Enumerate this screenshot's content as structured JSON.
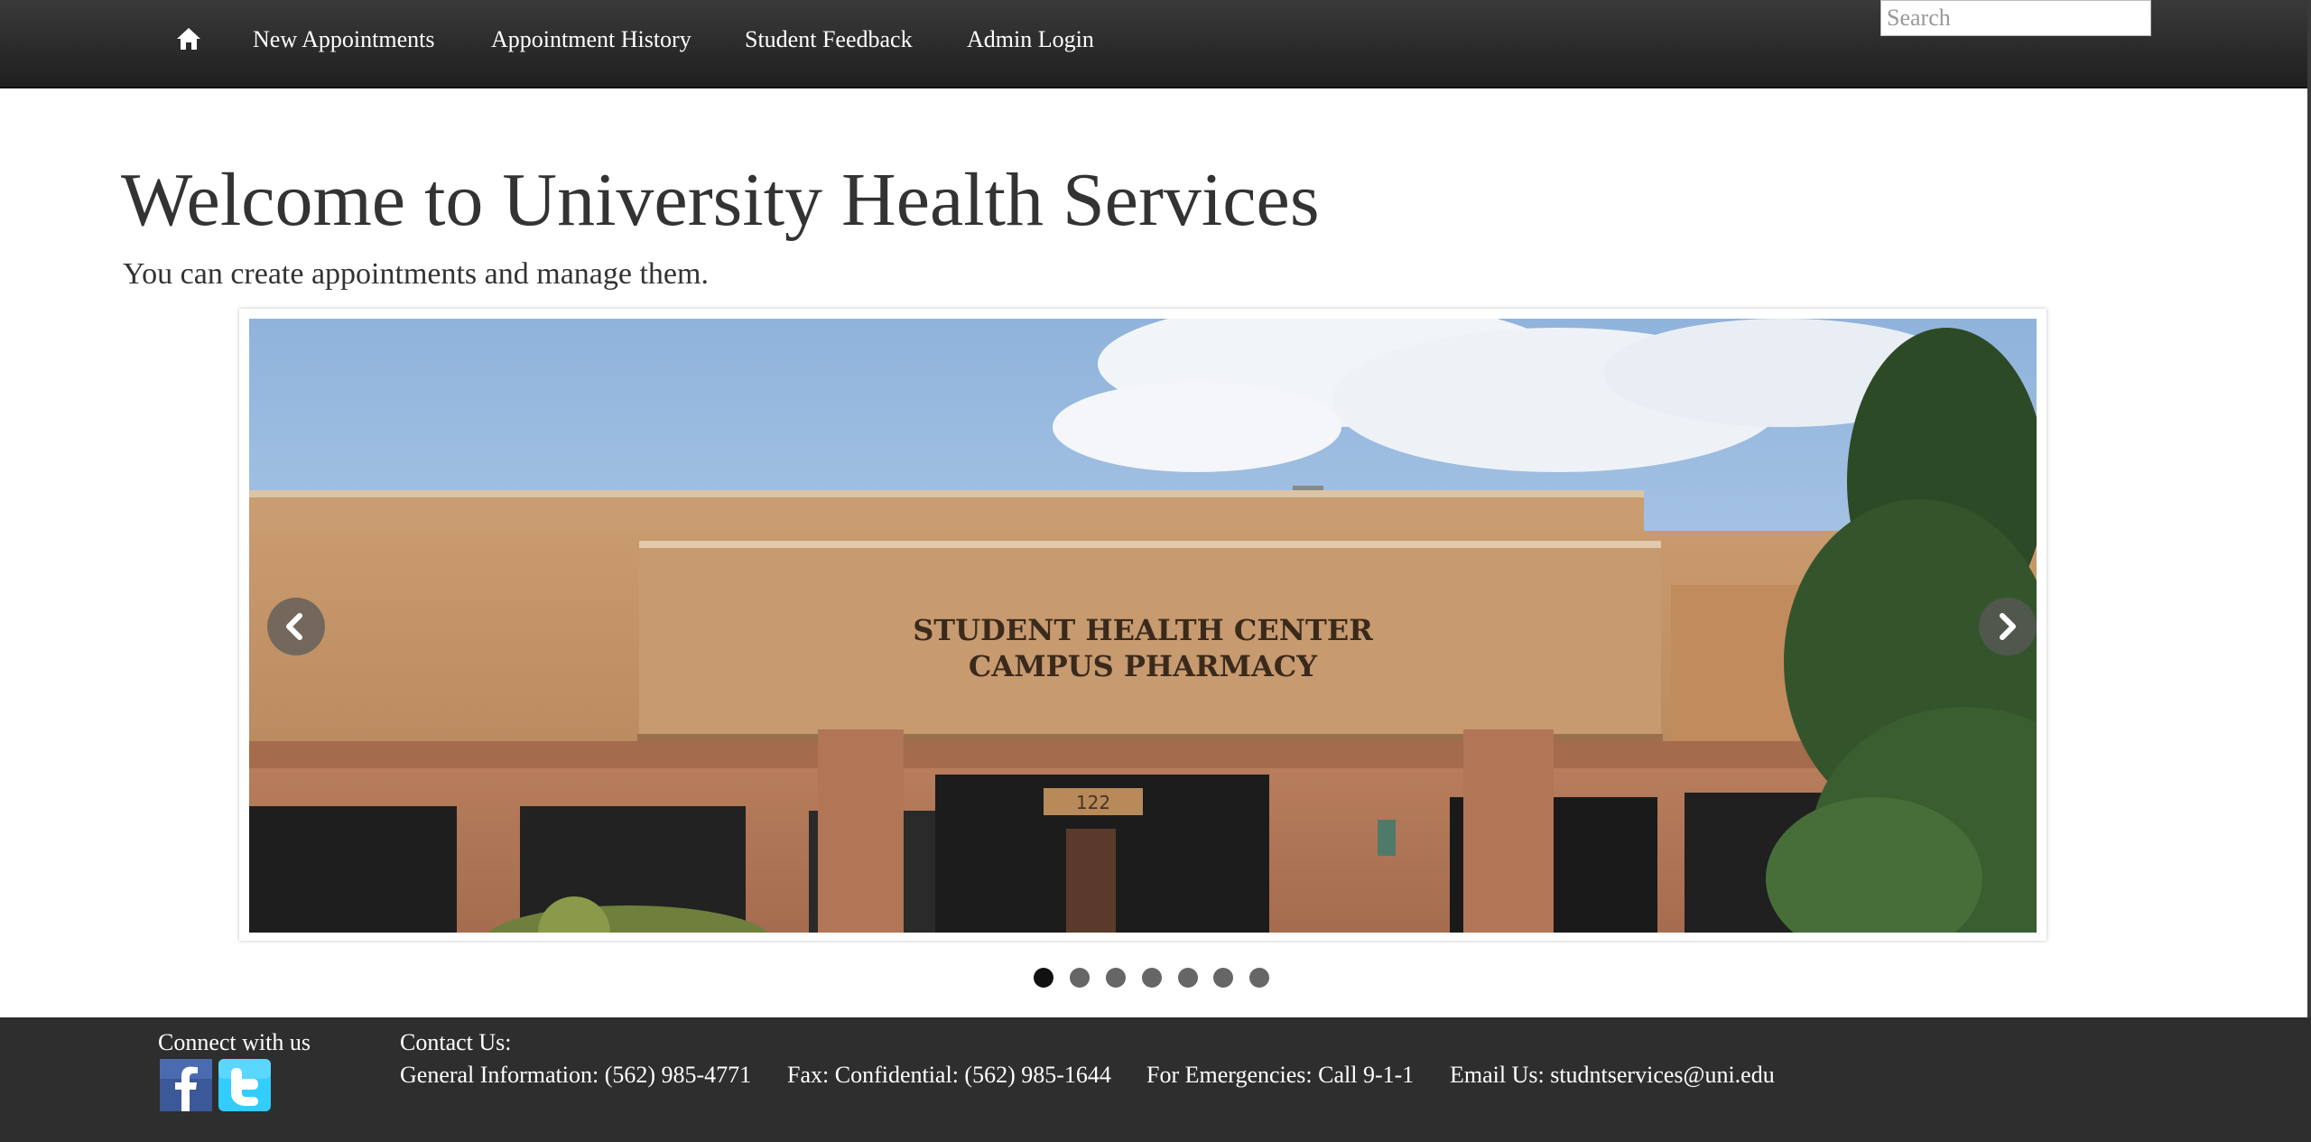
{
  "nav": {
    "items": [
      {
        "label": "New Appointments"
      },
      {
        "label": "Appointment History"
      },
      {
        "label": "Student Feedback"
      },
      {
        "label": "Admin Login"
      }
    ],
    "search_placeholder": "Search"
  },
  "hero": {
    "title": "Welcome to University Health Services",
    "subtitle": "You can create appointments and manage them."
  },
  "carousel": {
    "sign_line1": "STUDENT HEALTH CENTER",
    "sign_line2": "CAMPUS PHARMACY",
    "building_number": "122",
    "slide_count": 7,
    "active_index": 0
  },
  "footer": {
    "connect_label": "Connect with us",
    "contact_label": "Contact Us:",
    "general_info": "General Information: (562) 985-4771",
    "fax": "Fax: Confidential: (562) 985-1644",
    "emergencies": "For Emergencies: Call 9-1-1",
    "email": "Email Us: studntservices@uni.edu",
    "social": [
      "facebook-icon",
      "twitter-icon"
    ]
  },
  "colors": {
    "navbar": "#2a2a2a",
    "footer": "#2e2e2e",
    "facebook": "#3b5998",
    "twitter": "#33ccff"
  }
}
